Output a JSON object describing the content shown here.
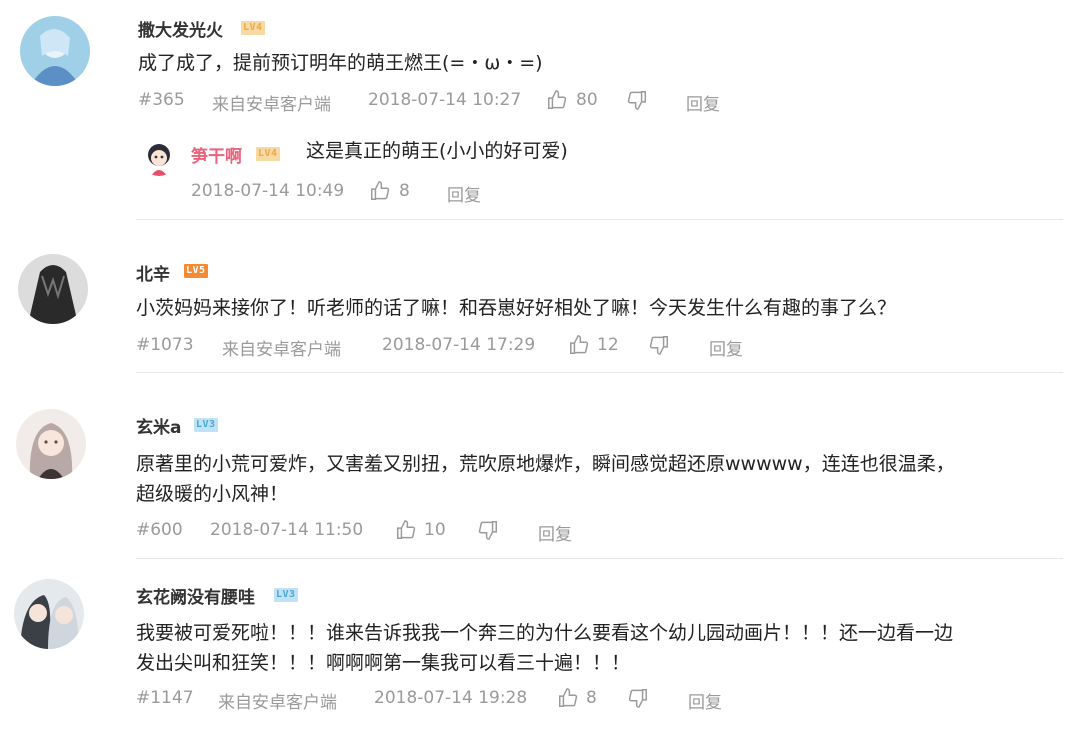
{
  "comments": [
    {
      "username": "撒大发光火",
      "level": "LV4",
      "text": "成了成了，提前预订明年的萌王燃王(=・ω・=)",
      "floor": "#365",
      "source": "来自安卓客户端",
      "time": "2018-07-14 10:27",
      "likes": "80",
      "reply_label": "回复",
      "sub_reply": {
        "username": "笋干啊",
        "level": "LV4",
        "text": "这是真正的萌王(小小的好可爱)",
        "time": "2018-07-14 10:49",
        "likes": "8",
        "reply_label": "回复"
      }
    },
    {
      "username": "北辛",
      "level": "LV5",
      "text": "小茨妈妈来接你了！听老师的话了嘛！和吞崽好好相处了嘛！今天发生什么有趣的事了么？",
      "floor": "#1073",
      "source": "来自安卓客户端",
      "time": "2018-07-14 17:29",
      "likes": "12",
      "reply_label": "回复"
    },
    {
      "username": "玄米a",
      "level": "LV3",
      "text_line1": "原著里的小荒可爱炸，又害羞又别扭，荒吹原地爆炸，瞬间感觉超还原wwwww，连连也很温柔，",
      "text_line2": "超级暖的小风神！",
      "floor": "#600",
      "time": "2018-07-14 11:50",
      "likes": "10",
      "reply_label": "回复"
    },
    {
      "username": "玄花阙没有腰哇",
      "level": "LV3",
      "text_line1": "我要被可爱死啦！！！谁来告诉我我一个奔三的为什么要看这个幼儿园动画片！！！还一边看一边",
      "text_line2": "发出尖叫和狂笑！！！啊啊啊第一集我可以看三十遍！！！",
      "floor": "#1147",
      "source": "来自安卓客户端",
      "time": "2018-07-14 19:28",
      "likes": "8",
      "reply_label": "回复"
    }
  ],
  "icons": {
    "like": "thumbs-up-icon",
    "dislike": "thumbs-down-icon"
  },
  "colors": {
    "meta": "#9a9a9a",
    "sub_username": "#e8637b",
    "lv4": "#f0a84a",
    "lv5": "#f58b33",
    "lv3": "#4aa8d8"
  }
}
